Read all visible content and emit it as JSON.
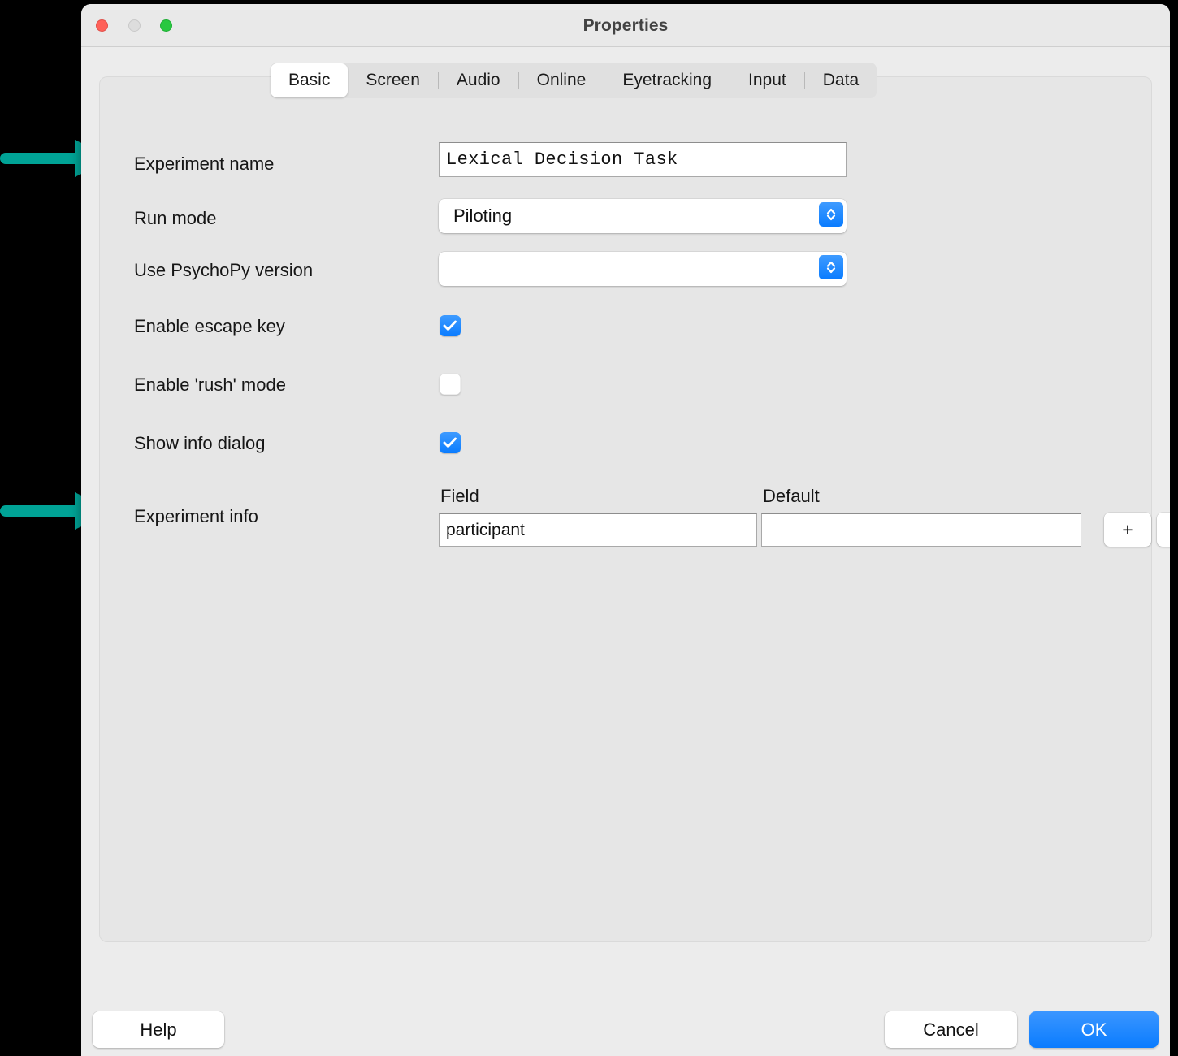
{
  "window": {
    "title": "Properties",
    "traffic_lights": {
      "close": "close-button",
      "minimize": "minimize-button",
      "maximize": "maximize-button"
    },
    "colors": {
      "close": "#ff6159",
      "minimize": "#dddddd",
      "maximize": "#28c840",
      "accent": "#0a7cff",
      "annotation_arrow": "#00a396",
      "window_bg": "#ececec",
      "panel_bg": "#e6e6e6"
    }
  },
  "tabs": [
    {
      "label": "Basic",
      "active": true
    },
    {
      "label": "Screen",
      "active": false
    },
    {
      "label": "Audio",
      "active": false
    },
    {
      "label": "Online",
      "active": false
    },
    {
      "label": "Eyetracking",
      "active": false
    },
    {
      "label": "Input",
      "active": false
    },
    {
      "label": "Data",
      "active": false
    }
  ],
  "form": {
    "experiment_name": {
      "label": "Experiment name",
      "value": "Lexical Decision Task"
    },
    "run_mode": {
      "label": "Run mode",
      "value": "Piloting"
    },
    "psychopy_version": {
      "label": "Use PsychoPy version",
      "value": ""
    },
    "enable_escape_key": {
      "label": "Enable escape key",
      "checked": true
    },
    "enable_rush_mode": {
      "label": "Enable 'rush' mode",
      "checked": false
    },
    "show_info_dialog": {
      "label": "Show info dialog",
      "checked": true
    },
    "experiment_info": {
      "label": "Experiment info",
      "columns": {
        "field": "Field",
        "default": "Default"
      },
      "rows": [
        {
          "field": "participant",
          "default": ""
        }
      ],
      "add_label": "+",
      "remove_label": "-"
    }
  },
  "footer": {
    "help_label": "Help",
    "cancel_label": "Cancel",
    "ok_label": "OK"
  },
  "annotations": {
    "arrow_1_target": "Experiment name",
    "arrow_2_target": "Experiment info"
  }
}
